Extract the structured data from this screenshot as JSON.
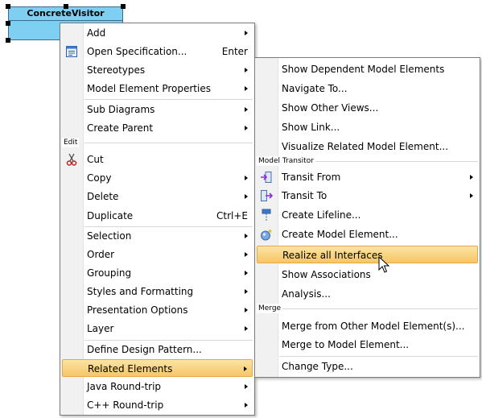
{
  "diagram": {
    "shape_name": "ConcreteVisitor",
    "shape_color": "#7fcff3"
  },
  "main_menu": {
    "items": [
      {
        "label": "Add",
        "submenu": true
      },
      {
        "label": "Open Specification...",
        "accel": "Enter",
        "icon": "specification-icon"
      },
      {
        "label": "Stereotypes",
        "submenu": true
      },
      {
        "label": "Model Element Properties",
        "submenu": true
      },
      {
        "label": "Sub Diagrams",
        "submenu": true
      },
      {
        "label": "Create Parent",
        "submenu": true
      },
      {
        "label": "Cut",
        "icon": "scissors-icon"
      },
      {
        "label": "Copy",
        "submenu": true
      },
      {
        "label": "Delete",
        "submenu": true
      },
      {
        "label": "Duplicate",
        "accel": "Ctrl+E"
      },
      {
        "label": "Selection",
        "submenu": true
      },
      {
        "label": "Order",
        "submenu": true
      },
      {
        "label": "Grouping",
        "submenu": true
      },
      {
        "label": "Styles and Formatting",
        "submenu": true
      },
      {
        "label": "Presentation Options",
        "submenu": true
      },
      {
        "label": "Layer",
        "submenu": true
      },
      {
        "label": "Define Design Pattern..."
      },
      {
        "label": "Related Elements",
        "submenu": true,
        "highlighted": true
      },
      {
        "label": "Java Round-trip",
        "submenu": true
      },
      {
        "label": "C++ Round-trip",
        "submenu": true
      }
    ],
    "groups": {
      "edit": "Edit"
    }
  },
  "sub_menu": {
    "items": [
      {
        "label": "Show Dependent Model Elements"
      },
      {
        "label": "Navigate To..."
      },
      {
        "label": "Show Other Views..."
      },
      {
        "label": "Show Link..."
      },
      {
        "label": "Visualize Related Model Element..."
      },
      {
        "label": "Transit From",
        "submenu": true,
        "icon": "transit-from-icon"
      },
      {
        "label": "Transit To",
        "submenu": true,
        "icon": "transit-to-icon"
      },
      {
        "label": "Create Lifeline...",
        "icon": "lifeline-icon"
      },
      {
        "label": "Create Model Element...",
        "icon": "model-element-icon"
      },
      {
        "label": "Realize all Interfaces",
        "highlighted": true
      },
      {
        "label": "Show Associations"
      },
      {
        "label": "Analysis..."
      },
      {
        "label": "Merge from Other Model Element(s)..."
      },
      {
        "label": "Merge to Model Element..."
      },
      {
        "label": "Change Type..."
      }
    ],
    "groups": {
      "model_transitor": "Model Transitor",
      "merge": "Merge"
    }
  },
  "colors": {
    "highlight_top": "#fbe4a3",
    "highlight_bottom": "#f6c667",
    "menu_border": "#7a7a7a"
  }
}
